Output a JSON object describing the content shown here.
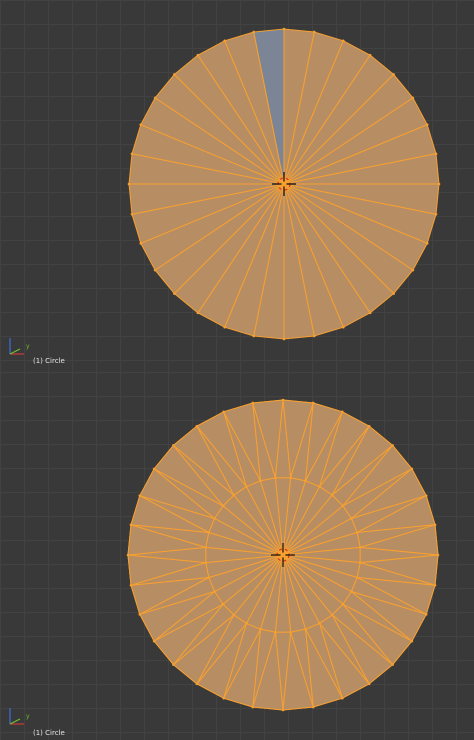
{
  "viewports": [
    {
      "object_label": "(1) Circle",
      "axis_label": "y",
      "mesh": {
        "type": "triangle-fan",
        "segments": 32,
        "unselected_faces": 1
      }
    },
    {
      "object_label": "(1) Circle",
      "axis_label": "y",
      "mesh": {
        "type": "inset-ring-fill",
        "segments": 32,
        "inner_ring_ratio": 0.5
      }
    }
  ],
  "colors": {
    "background": "#393939",
    "grid": "#424242",
    "face_selected": "#b78d63",
    "face_unselected": "#7c8596",
    "edge_selected": "#f7a030",
    "cursor_red": "#d93a20",
    "axis_x": "#c93a3a",
    "axis_y": "#6fbf2f",
    "axis_z": "#3a6fdf"
  }
}
